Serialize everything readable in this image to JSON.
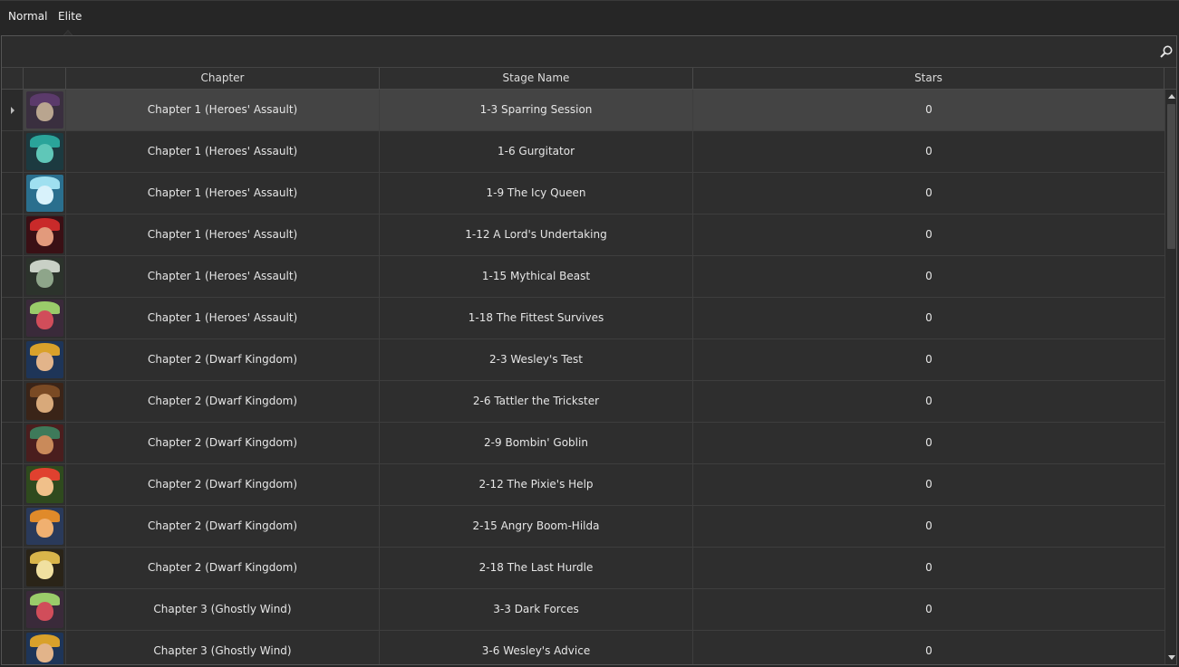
{
  "tabs": [
    {
      "label": "Normal",
      "active": false
    },
    {
      "label": "Elite",
      "active": true
    }
  ],
  "search": {
    "icon": "search-icon",
    "value": ""
  },
  "columns": {
    "chapter": "Chapter",
    "stage": "Stage Name",
    "stars": "Stars"
  },
  "rows": [
    {
      "chapter": "Chapter 1 (Heroes' Assault)",
      "stage": "1-3 Sparring Session",
      "stars": "0",
      "selected": true,
      "portrait": {
        "bg": "#3a2f3f",
        "hat": "#5b3a6b",
        "face": "#b9a58f"
      }
    },
    {
      "chapter": "Chapter 1 (Heroes' Assault)",
      "stage": "1-6 Gurgitator",
      "stars": "0",
      "portrait": {
        "bg": "#1c3a40",
        "hat": "#2aa49a",
        "face": "#5fc7b8"
      }
    },
    {
      "chapter": "Chapter 1 (Heroes' Assault)",
      "stage": "1-9 The Icy Queen",
      "stars": "0",
      "portrait": {
        "bg": "#2a6f8e",
        "hat": "#9fe0f0",
        "face": "#d8f2fb"
      }
    },
    {
      "chapter": "Chapter 1 (Heroes' Assault)",
      "stage": "1-12 A Lord's Undertaking",
      "stars": "0",
      "portrait": {
        "bg": "#3a1015",
        "hat": "#c92a2a",
        "face": "#e29a7c"
      }
    },
    {
      "chapter": "Chapter 1 (Heroes' Assault)",
      "stage": "1-15 Mythical Beast",
      "stars": "0",
      "portrait": {
        "bg": "#2c332c",
        "hat": "#c9d0c6",
        "face": "#8ea58a"
      }
    },
    {
      "chapter": "Chapter 1 (Heroes' Assault)",
      "stage": "1-18 The Fittest Survives",
      "stars": "0",
      "portrait": {
        "bg": "#3a2a3a",
        "hat": "#9acb6a",
        "face": "#d14d5a"
      }
    },
    {
      "chapter": "Chapter 2 (Dwarf Kingdom)",
      "stage": "2-3 Wesley's Test",
      "stars": "0",
      "portrait": {
        "bg": "#1e3558",
        "hat": "#d9a12a",
        "face": "#e2b48a"
      }
    },
    {
      "chapter": "Chapter 2 (Dwarf Kingdom)",
      "stage": "2-6 Tattler the Trickster",
      "stars": "0",
      "portrait": {
        "bg": "#3a2418",
        "hat": "#7a4a24",
        "face": "#d8a97a"
      }
    },
    {
      "chapter": "Chapter 2 (Dwarf Kingdom)",
      "stage": "2-9 Bombin' Goblin",
      "stars": "0",
      "portrait": {
        "bg": "#4a1e1e",
        "hat": "#3e7a5a",
        "face": "#c98a5a"
      }
    },
    {
      "chapter": "Chapter 2 (Dwarf Kingdom)",
      "stage": "2-12 The Pixie's Help",
      "stars": "0",
      "portrait": {
        "bg": "#2f4a1e",
        "hat": "#e0412f",
        "face": "#f0c08a"
      }
    },
    {
      "chapter": "Chapter 2 (Dwarf Kingdom)",
      "stage": "2-15 Angry Boom-Hilda",
      "stars": "0",
      "portrait": {
        "bg": "#2a3a5a",
        "hat": "#e08a2a",
        "face": "#f0b070"
      }
    },
    {
      "chapter": "Chapter 2 (Dwarf Kingdom)",
      "stage": "2-18 The Last Hurdle",
      "stars": "0",
      "portrait": {
        "bg": "#2a2418",
        "hat": "#d9b54a",
        "face": "#f0e0a0"
      }
    },
    {
      "chapter": "Chapter 3 (Ghostly Wind)",
      "stage": "3-3 Dark Forces",
      "stars": "0",
      "portrait": {
        "bg": "#3a2a3a",
        "hat": "#9acb6a",
        "face": "#d14d5a"
      }
    },
    {
      "chapter": "Chapter 3 (Ghostly Wind)",
      "stage": "3-6 Wesley's Advice",
      "stars": "0",
      "portrait": {
        "bg": "#1e3558",
        "hat": "#d9a12a",
        "face": "#e2b48a"
      }
    }
  ]
}
